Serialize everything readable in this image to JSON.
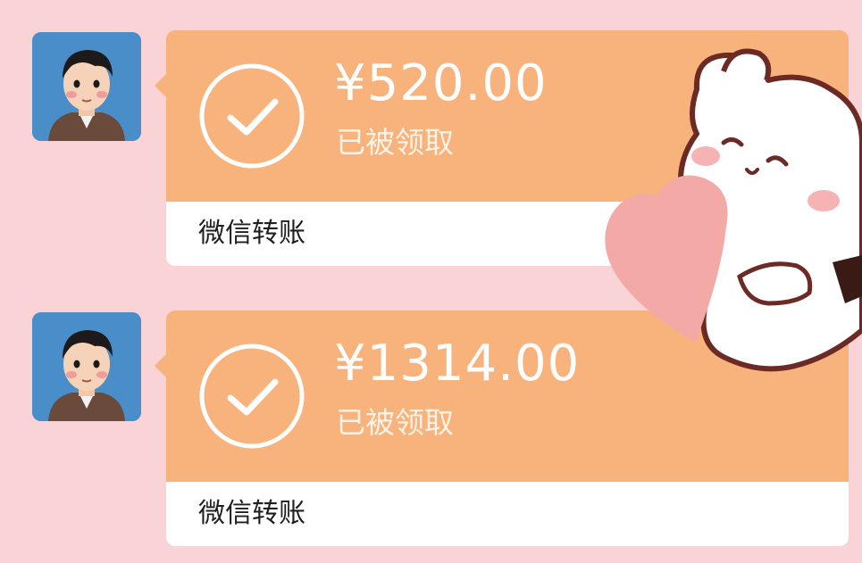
{
  "colors": {
    "background": "#f9d3d6",
    "bubble_orange": "#f8b27c",
    "bubble_white": "#ffffff",
    "text_white": "#ffffff",
    "footer_text": "#1f1f1f",
    "avatar_bg": "#4a8ec9"
  },
  "messages": [
    {
      "avatar_icon": "avatar-icon",
      "status_icon": "check-circle-icon",
      "amount": "¥520.00",
      "status": "已被领取",
      "footer_label": "微信转账"
    },
    {
      "avatar_icon": "avatar-icon",
      "status_icon": "check-circle-icon",
      "amount": "¥1314.00",
      "status": "已被领取",
      "footer_label": "微信转账"
    }
  ],
  "sticker": {
    "icon": "bear-holding-heart-sticker"
  }
}
